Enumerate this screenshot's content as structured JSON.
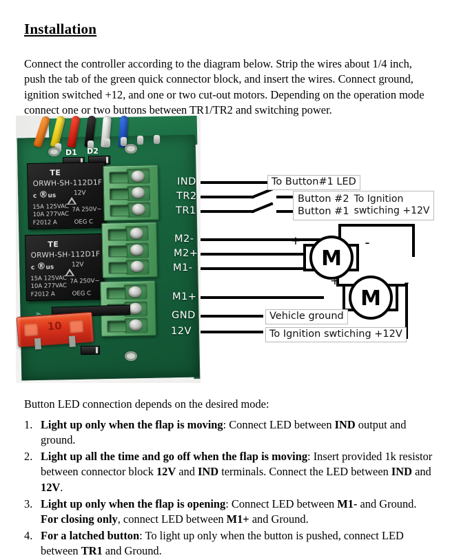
{
  "document": {
    "title": "Installation",
    "intro": "Connect the controller according to the diagram below. Strip the wires about 1/4 inch, push the tab of the green quick connector block, and insert the wires. Connect ground, ignition switched +12, and one or two cut-out motors. Depending on the operation mode connect one or two buttons between TR1/TR2 and switching power.",
    "lead_in": "Button LED connection depends on the desired mode:",
    "modes": [
      {
        "num": "1.",
        "bold": "Light up only when the flap is moving",
        "rest": ": Connect LED between ",
        "b2": "IND",
        "rest2": " output and ground.",
        "full": "Light up only when the flap is moving: Connect LED between IND output and ground."
      },
      {
        "num": "2.",
        "bold": "Light up all the time and go off when the flap is moving",
        "full": "Light up all the time and go off when the flap is moving: Insert provided 1k resistor between connector block 12V and IND terminals. Connect the LED between IND and 12V."
      },
      {
        "num": "3.",
        "bold": "Light up only when the flap is opening",
        "full": "Light up only when the flap is opening: Connect LED between M1- and Ground. For closing only, connect LED between M1+ and Ground."
      },
      {
        "num": "4.",
        "bold": "For a latched button",
        "full": "For a latched button: To light up only when the button is pushed, connect LED between TR1 and Ground."
      }
    ]
  },
  "board": {
    "silkscreen": {
      "d1": "D1",
      "d2": "D2",
      "side_text": "rity"
    },
    "relay": {
      "brand": "TE",
      "part_number": "ORWH-SH-112D1F",
      "coil_voltage": "12V",
      "ul_mark": "c UL us",
      "rating_1": "15A 125VAC",
      "rating_2": "10A 277VAC",
      "rating_3": "7A  250V~",
      "date_code": "F2012  A",
      "maker": "OEG   C"
    },
    "fuse": {
      "rating": "10"
    },
    "wire_colors": [
      "#f07a18",
      "#f2d517",
      "#e02718",
      "#141414",
      "#e8e8e6",
      "#1850c8"
    ],
    "terminal_labels": [
      "IND",
      "TR2",
      "TR1",
      "M2-",
      "M2+",
      "M1-",
      "M1+",
      "GND",
      "12V"
    ]
  },
  "schematic": {
    "callouts": {
      "led": "To Button#1 LED",
      "button2": "Button #2",
      "button1": "Button #1",
      "ignition_line1": "To Ignition",
      "ignition_line2": "swtiching +12V",
      "vehicle_ground": "Vehicle ground",
      "ignition_12v": "To Ignition swtiching +12V"
    },
    "motors": [
      {
        "symbol": "M",
        "plus": "+",
        "minus": "-"
      },
      {
        "symbol": "M",
        "plus": "+",
        "minus": "-"
      }
    ]
  },
  "colors": {
    "pcb_green": "#1d6b43",
    "terminal_green": "#5da86c",
    "fuse_red": "#e8301a",
    "wire_ink": "#000000"
  }
}
